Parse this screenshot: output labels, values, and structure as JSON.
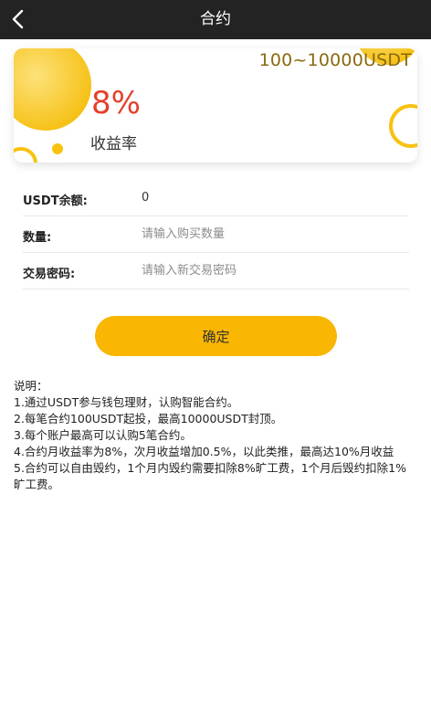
{
  "header": {
    "title": "合约",
    "back_icon": "chevron-left-icon"
  },
  "card": {
    "range": "100~10000USDT",
    "rate": "8%",
    "rate_label": "收益率",
    "accent_color": "#f9c414",
    "rate_color": "#e3412c"
  },
  "form": {
    "balance_label": "USDT余额:",
    "balance_value": "0",
    "quantity_label": "数量:",
    "quantity_placeholder": "请输入购买数量",
    "password_label": "交易密码:",
    "password_placeholder": "请输入新交易密码"
  },
  "confirm_label": "确定",
  "notes": {
    "title": "说明：",
    "items": [
      "1.通过USDT参与钱包理财，认购智能合约。",
      "2.每笔合约100USDT起投，最高10000USDT封顶。",
      "3.每个账户最高可以认购5笔合约。",
      "4.合约月收益率为8%，次月收益增加0.5%，以此类推，最高达10%月收益",
      "5.合约可以自由毁约，1个月内毁约需要扣除8%旷工费，1个月后毁约扣除1%旷工费。"
    ]
  }
}
